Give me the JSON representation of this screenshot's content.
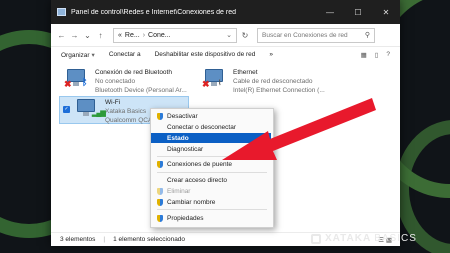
{
  "window": {
    "title": "Panel de control\\Redes e Internet\\Conexiones de red",
    "minimize_glyph": "—",
    "maximize_glyph": "☐",
    "close_glyph": "✕"
  },
  "nav": {
    "back": "←",
    "forward": "→",
    "recent": "⌄",
    "up": "↑",
    "address": {
      "root_chevron": "«",
      "seg1": "Re...",
      "sep": "›",
      "seg2": "Cone...",
      "dropdown": "⌄"
    },
    "refresh": "↻",
    "search_placeholder": "Buscar en Conexiones de red",
    "search_icon": "search-icon"
  },
  "toolbar": {
    "organize": "Organizar",
    "connect": "Conectar a",
    "disable": "Deshabilitar este dispositivo de red",
    "dropdown": "▾",
    "more": "»",
    "view_icon": "view-options-icon",
    "preview_icon": "preview-pane-icon",
    "help": "?"
  },
  "connections": [
    {
      "name": "Conexión de red Bluetooth",
      "status": "No conectado",
      "device": "Bluetooth Device (Personal Ar...",
      "badge": "✖",
      "badge2": "ᛒ"
    },
    {
      "name": "Ethernet",
      "status": "Cable de red desconectado",
      "device": "Intel(R) Ethernet Connection (...",
      "badge": "✖",
      "badge2": "⌇"
    },
    {
      "name": "Wi-Fi",
      "status": "Xataka Basics",
      "device": "Qualcomm QCA6",
      "badge": "▂▄▆",
      "check": "✓"
    }
  ],
  "context_menu": {
    "items": [
      {
        "label": "Desactivar",
        "shield": true
      },
      {
        "label": "Conectar o desconectar",
        "shield": false
      },
      {
        "label": "Estado",
        "shield": false
      },
      {
        "label": "Diagnosticar",
        "shield": false
      },
      {
        "label": "Conexiones de puente",
        "shield": true
      },
      {
        "label": "Crear acceso directo",
        "shield": false
      },
      {
        "label": "Eliminar",
        "shield": true
      },
      {
        "label": "Cambiar nombre",
        "shield": true
      },
      {
        "label": "Propiedades",
        "shield": true
      }
    ]
  },
  "status_bar": {
    "count": "3 elementos",
    "separator": "|",
    "selected": "1 elemento seleccionado",
    "views": "☰ ▦"
  },
  "watermark": {
    "brand": "XATAKA",
    "product": "BASICS"
  },
  "colors": {
    "selection_bg": "#cde4f7",
    "menu_highlight": "#0b5fc4",
    "arrow": "#e8192c",
    "titlebar": "#1f1f1f"
  }
}
